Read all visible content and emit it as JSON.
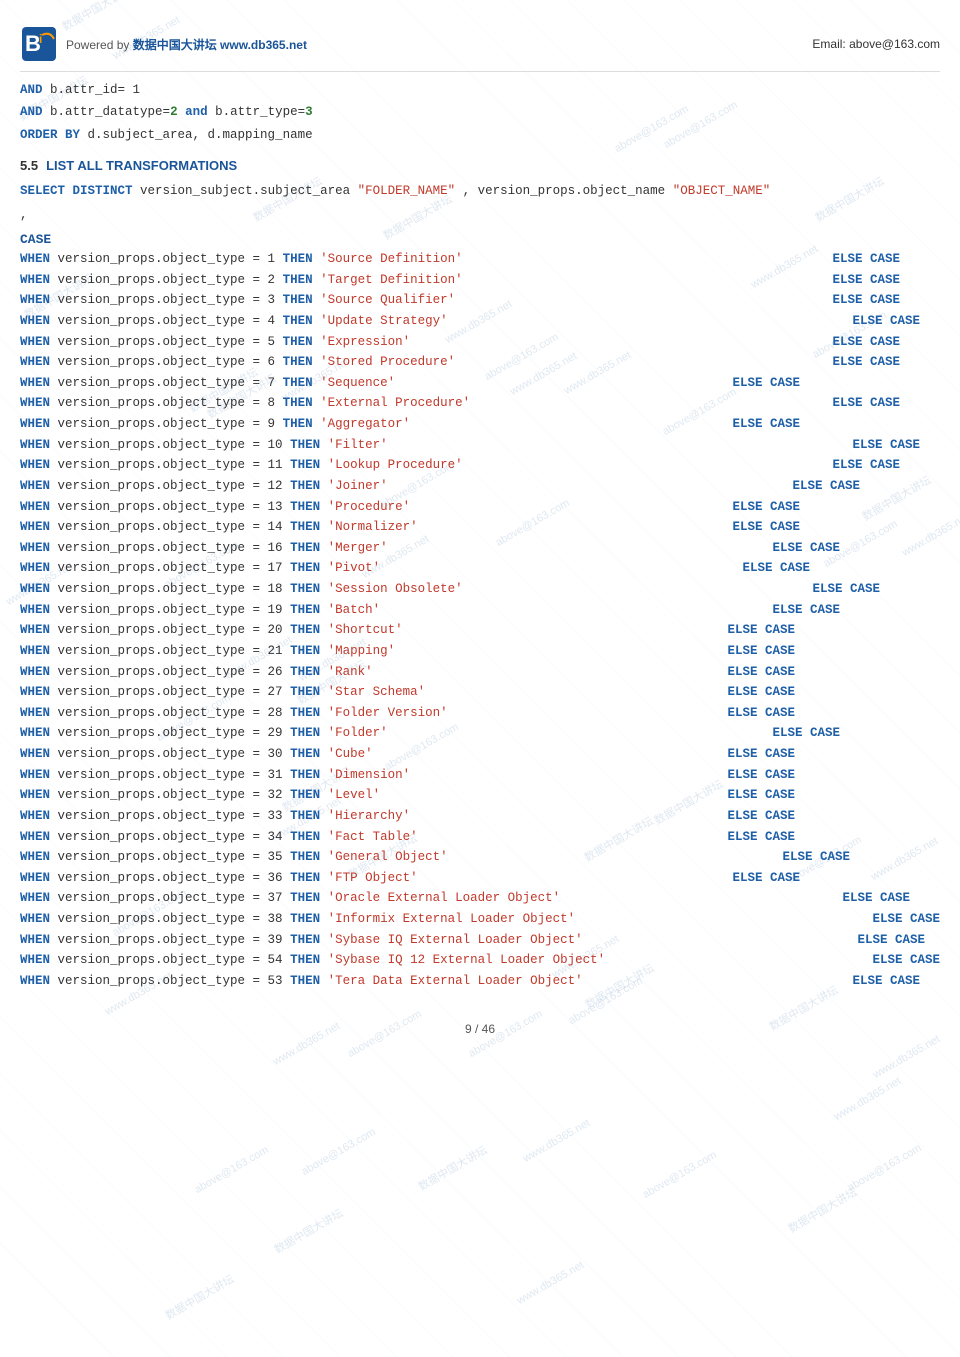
{
  "header": {
    "powered_by_text": "Powered by",
    "site_name": "数据中国大讲坛  www.db365.net",
    "email_label": "Email: above@163.com"
  },
  "sql_lines": [
    {
      "id": "line1",
      "parts": [
        {
          "type": "kw-blue",
          "text": "AND"
        },
        {
          "type": "normal",
          "text": " b.attr_id= 1"
        }
      ]
    },
    {
      "id": "line2",
      "parts": [
        {
          "type": "kw-blue",
          "text": "AND"
        },
        {
          "type": "normal",
          "text": " b.attr_datatype="
        },
        {
          "type": "kw-green",
          "text": "2"
        },
        {
          "type": "normal",
          "text": " "
        },
        {
          "type": "kw-blue",
          "text": "and"
        },
        {
          "type": "normal",
          "text": " b.attr_type="
        },
        {
          "type": "kw-green",
          "text": "3"
        }
      ]
    },
    {
      "id": "line3",
      "parts": [
        {
          "type": "kw-blue",
          "text": "ORDER BY"
        },
        {
          "type": "normal",
          "text": " d.subject_area, d.mapping_name"
        }
      ]
    }
  ],
  "section": {
    "number": "5.5",
    "title": "LIST ALL TRANSFORMATIONS"
  },
  "select_statement": "SELECT DISTINCT version_subject.subject_area ",
  "select_statement2": "\"FOLDER_NAME\",   version_props.object_name \"OBJECT_NAME\"",
  "comma_line": ",",
  "case_keyword": "CASE",
  "when_lines": [
    {
      "id": "w1",
      "main": "WHEN version_props.object_type = 1 THEN 'Source Definition'",
      "else_pos": "right",
      "else_indent": 360
    },
    {
      "id": "w2",
      "main": "WHEN version_props.object_type = 2 THEN 'Target Definition'",
      "else_pos": "right",
      "else_indent": 360
    },
    {
      "id": "w3",
      "main": "WHEN version_props.object_type = 3 THEN 'Source Qualifier'",
      "else_pos": "right",
      "else_indent": 360
    },
    {
      "id": "w4",
      "main": "WHEN version_props.object_type = 4 THEN 'Update Strategy'",
      "else_pos": "right",
      "else_indent": 380
    },
    {
      "id": "w5",
      "main": "WHEN version_props.object_type = 5 THEN 'Expression'",
      "else_pos": "right",
      "else_indent": 360
    },
    {
      "id": "w6",
      "main": "WHEN version_props.object_type = 6 THEN 'Stored Procedure'",
      "else_pos": "right",
      "else_indent": 360
    },
    {
      "id": "w7",
      "main": "WHEN version_props.object_type = 7 THEN 'Sequence'",
      "else_pos": "mid",
      "else_indent": 310
    },
    {
      "id": "w8",
      "main": "WHEN version_props.object_type = 8 THEN 'External Procedure'",
      "else_pos": "right",
      "else_indent": 360
    },
    {
      "id": "w9",
      "main": "WHEN version_props.object_type = 9 THEN 'Aggregator'",
      "else_pos": "mid",
      "else_indent": 310
    },
    {
      "id": "w10",
      "main": "WHEN version_props.object_type = 10 THEN 'Filter'",
      "else_pos": "far",
      "else_indent": 490
    },
    {
      "id": "w11",
      "main": "WHEN version_props.object_type = 11 THEN 'Lookup Procedure'",
      "else_pos": "right",
      "else_indent": 360
    },
    {
      "id": "w12",
      "main": "WHEN version_props.object_type = 12 THEN 'Joiner'",
      "else_pos": "right",
      "else_indent": 400
    },
    {
      "id": "w13",
      "main": "WHEN version_props.object_type = 13 THEN 'Procedure'",
      "else_pos": "mid",
      "else_indent": 310
    },
    {
      "id": "w14",
      "main": "WHEN version_props.object_type = 14 THEN 'Normalizer'",
      "else_pos": "mid",
      "else_indent": 310
    },
    {
      "id": "w16",
      "main": "WHEN version_props.object_type = 16 THEN 'Merger'",
      "else_pos": "right",
      "else_indent": 390
    },
    {
      "id": "w17",
      "main": "WHEN version_props.object_type = 17 THEN 'Pivot'",
      "else_pos": "mid",
      "else_indent": 320
    },
    {
      "id": "w18",
      "main": "WHEN version_props.object_type = 18 THEN 'Session Obsolete'",
      "else_pos": "right",
      "else_indent": 370
    },
    {
      "id": "w19",
      "main": "WHEN version_props.object_type = 19 THEN 'Batch'",
      "else_pos": "right",
      "else_indent": 400
    },
    {
      "id": "w20",
      "main": "WHEN version_props.object_type = 20 THEN 'Shortcut'",
      "else_pos": "mid2",
      "else_indent": 310
    },
    {
      "id": "w21",
      "main": "WHEN version_props.object_type = 21 THEN 'Mapping'",
      "else_pos": "mid2",
      "else_indent": 310
    },
    {
      "id": "w26",
      "main": "WHEN version_props.object_type = 26 THEN 'Rank'",
      "else_pos": "mid2",
      "else_indent": 310
    },
    {
      "id": "w27",
      "main": "WHEN version_props.object_type = 27 THEN 'Star Schema'",
      "else_pos": "mid2",
      "else_indent": 310
    },
    {
      "id": "w28",
      "main": "WHEN version_props.object_type = 28 THEN 'Folder Version'",
      "else_pos": "mid2",
      "else_indent": 310
    },
    {
      "id": "w29",
      "main": "WHEN version_props.object_type = 29 THEN 'Folder'",
      "else_pos": "right",
      "else_indent": 400
    },
    {
      "id": "w30",
      "main": "WHEN version_props.object_type = 30 THEN 'Cube'",
      "else_pos": "mid2",
      "else_indent": 310
    },
    {
      "id": "w31",
      "main": "WHEN version_props.object_type = 31 THEN 'Dimension'",
      "else_pos": "mid2",
      "else_indent": 310
    },
    {
      "id": "w32",
      "main": "WHEN version_props.object_type = 32 THEN 'Level'",
      "else_pos": "mid2",
      "else_indent": 310
    },
    {
      "id": "w33",
      "main": "WHEN version_props.object_type = 33 THEN 'Hierarchy'",
      "else_pos": "mid2",
      "else_indent": 310
    },
    {
      "id": "w34",
      "main": "WHEN version_props.object_type = 34 THEN 'Fact Table'",
      "else_pos": "mid2",
      "else_indent": 310
    },
    {
      "id": "w35",
      "main": "WHEN version_props.object_type = 35 THEN 'General Object'",
      "else_pos": "right",
      "else_indent": 390
    },
    {
      "id": "w36",
      "main": "WHEN version_props.object_type = 36 THEN 'FTP Object'",
      "else_pos": "mid",
      "else_indent": 310
    },
    {
      "id": "w37",
      "main": "WHEN version_props.object_type = 37 THEN 'Oracle External Loader Object'",
      "else_pos": "mid3",
      "else_indent": 460
    },
    {
      "id": "w38",
      "main": "WHEN version_props.object_type = 38 THEN 'Informix External Loader Object'",
      "else_pos": "far2",
      "else_indent": 580
    },
    {
      "id": "w39",
      "main": "WHEN version_props.object_type = 39 THEN 'Sybase IQ External Loader Object'",
      "else_pos": "mid4",
      "else_indent": 490
    },
    {
      "id": "w54",
      "main": "WHEN version_props.object_type = 54 THEN 'Sybase IQ 12 External Loader Object'",
      "else_pos": "far3",
      "else_indent": 620
    },
    {
      "id": "w53",
      "main": "WHEN version_props.object_type = 53 THEN 'Tera Data External Loader Object'",
      "else_pos": "mid5",
      "else_indent": 490
    }
  ],
  "footer": {
    "page": "9 / 46"
  }
}
